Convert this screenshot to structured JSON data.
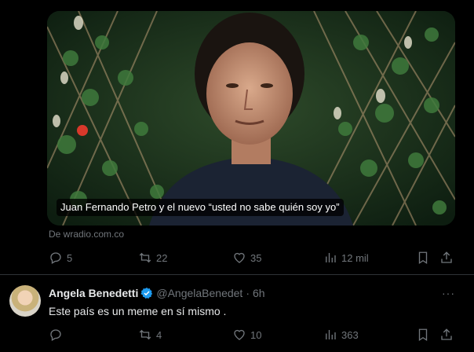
{
  "tweet1": {
    "card_caption": "Juan Fernando Petro y el nuevo “usted no sabe quién soy yo”",
    "source": "De wradio.com.co",
    "replies": "5",
    "reposts": "22",
    "likes": "35",
    "views": "12 mil"
  },
  "tweet2": {
    "name": "Angela Benedetti",
    "handle": "@AngelaBenedet",
    "separator": "·",
    "time": "6h",
    "more": "···",
    "text": "Este país es un meme en sí mismo .",
    "replies": "",
    "reposts": "4",
    "likes": "10",
    "views": "363"
  },
  "colors": {
    "background": "#000000",
    "muted": "#71767b",
    "text": "#e7e9ea",
    "verified": "#1d9bf0",
    "divider": "#2f3336"
  },
  "icons": [
    "reply-icon",
    "repost-icon",
    "like-icon",
    "views-icon",
    "bookmark-icon",
    "share-icon",
    "verified-icon",
    "more-icon"
  ]
}
